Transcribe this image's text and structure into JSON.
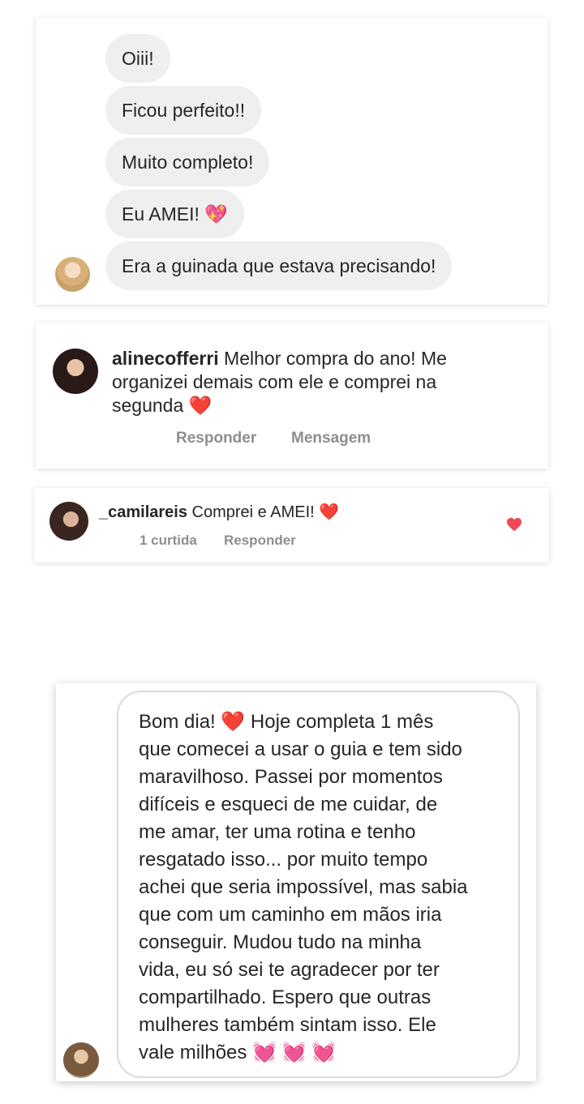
{
  "dm": {
    "messages": [
      {
        "text": "Oiii!"
      },
      {
        "text": "Ficou perfeito!!"
      },
      {
        "text": "Muito completo!"
      },
      {
        "text": "Eu AMEI!",
        "emoji": "💖"
      },
      {
        "text": "Era a guinada que estava precisando!"
      }
    ],
    "avatar_icon": "user-avatar"
  },
  "comment1": {
    "username": "alinecofferri",
    "text": "Melhor compra do ano! Me organizei demais com ele e comprei na segunda",
    "line1": "Melhor compra do ano! Me",
    "line2": "organizei demais com ele e comprei na",
    "line3": "segunda",
    "emoji": "❤️",
    "reply_label": "Responder",
    "message_label": "Mensagem"
  },
  "comment2": {
    "username": "_camilareis",
    "text": "Comprei e AMEI!",
    "emoji": "❤️",
    "likes_label": "1 curtida",
    "reply_label": "Responder",
    "like_icon": "heart-icon",
    "like_color": "#ed4956"
  },
  "message": {
    "lines": [
      "Bom dia! ❤️ Hoje completa 1 mês",
      "que comecei a usar o guia e tem sido",
      "maravilhoso. Passei por momentos",
      "difíceis e esqueci de me cuidar, de",
      "me amar, ter uma rotina e tenho",
      "resgatado isso... por muito tempo",
      "achei que seria impossível, mas sabia",
      "que com um caminho em mãos iria",
      "conseguir. Mudou tudo na minha",
      "vida, eu só sei te agradecer por ter",
      "compartilhado. Espero que outras",
      "mulheres também sintam isso. Ele",
      "vale milhões 💓 💓 💓"
    ]
  }
}
